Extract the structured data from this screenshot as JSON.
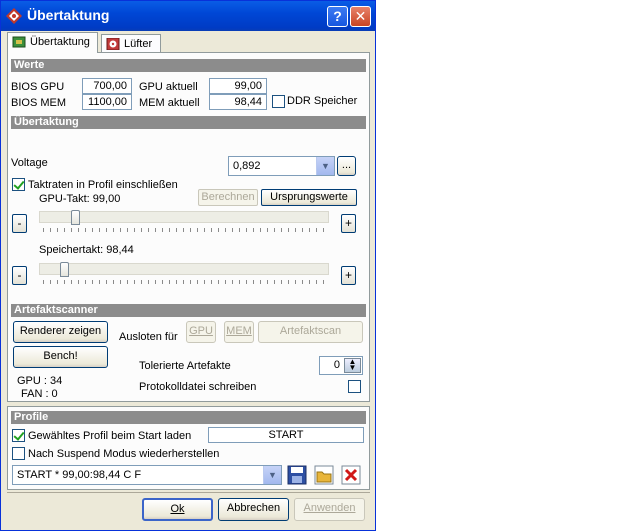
{
  "window": {
    "title": "Übertaktung",
    "help_glyph": "?",
    "close_glyph": "✕"
  },
  "tabs": [
    {
      "label": "Übertaktung",
      "active": true
    },
    {
      "label": "Lüfter",
      "active": false
    }
  ],
  "werte": {
    "heading": "Werte",
    "bios_gpu_label": "BIOS GPU",
    "bios_gpu_value": "700,00",
    "bios_mem_label": "BIOS MEM",
    "bios_mem_value": "1100,00",
    "gpu_aktuell_label": "GPU aktuell",
    "gpu_aktuell_value": "99,00",
    "mem_aktuell_label": "MEM aktuell",
    "mem_aktuell_value": "98,44",
    "ddr_label": "DDR Speicher",
    "ddr_checked": false
  },
  "uebertaktung": {
    "heading": "Übertaktung",
    "voltage_label": "Voltage",
    "voltage_value": "0,892",
    "voltage_more": "...",
    "include_label": "Taktraten in Profil einschließen",
    "include_checked": true,
    "gpu_takt_label": "GPU-Takt: 99,00",
    "berechnen": "Berechnen",
    "ursprungswerte": "Ursprungswerte",
    "speichertakt_label": "Speichertakt: 98,44",
    "minus": "-",
    "plus": "+",
    "gpu_slider_fraction": 0.1,
    "mem_slider_fraction": 0.06
  },
  "artefakt": {
    "heading": "Artefaktscanner",
    "renderer_btn": "Renderer zeigen",
    "bench_btn": "Bench!",
    "ausloten_label": "Ausloten für",
    "gpu_btn": "GPU",
    "mem_btn": "MEM",
    "scan_btn": "Artefaktscan",
    "tolerierte_label": "Tolerierte Artefakte",
    "tolerierte_value": "0",
    "protokoll_label": "Protokolldatei schreiben",
    "protokoll_checked": false,
    "gpu_status": "GPU : 34",
    "fan_status": "FAN : 0"
  },
  "profile": {
    "heading": "Profile",
    "start_label": "Gewähltes Profil beim Start laden",
    "start_checked": true,
    "start_value": "START",
    "suspend_label": "Nach Suspend Modus wiederherstellen",
    "suspend_checked": false,
    "profile_value": "START * 99,00:98,44 C  F"
  },
  "footer": {
    "ok": "Ok",
    "abbrechen": "Abbrechen",
    "anwenden": "Anwenden"
  },
  "colors": {
    "titlebar": "#0054e3",
    "section": "#8c8c8c",
    "panel": "#fcfcfc",
    "window": "#ece9d8"
  }
}
